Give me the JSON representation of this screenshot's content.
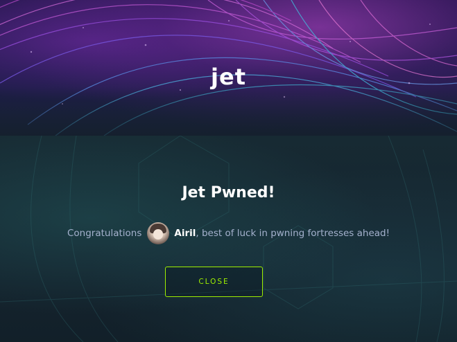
{
  "logo": {
    "text": "jet"
  },
  "modal": {
    "title": "Jet Pwned!",
    "message_lead": "Congratulations",
    "username": "Airil",
    "message_tail": ", best of luck in pwning fortresses ahead!",
    "close_label": "CLOSE"
  },
  "colors": {
    "accent": "#9fef00",
    "text_muted": "#a4b1cd",
    "background": "#141f2a"
  }
}
